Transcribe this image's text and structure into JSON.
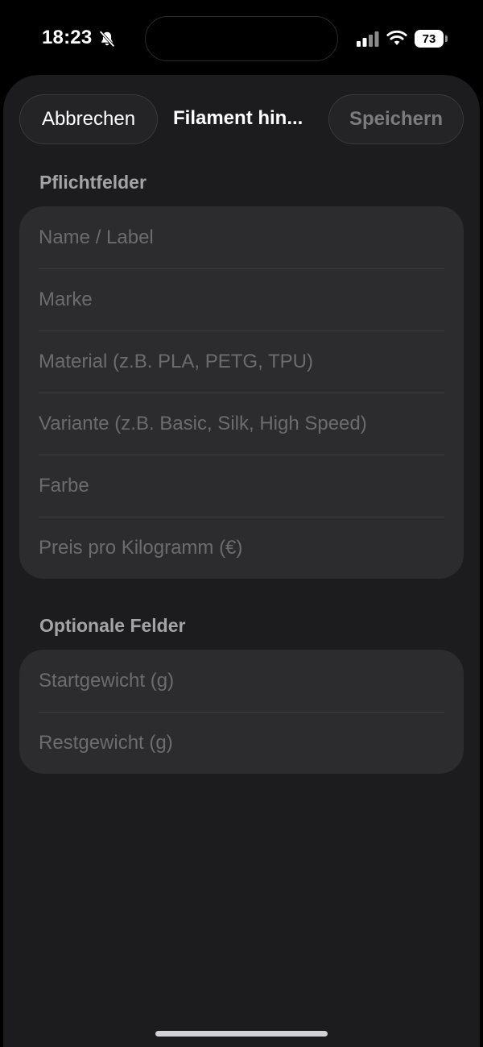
{
  "status_bar": {
    "time": "18:23",
    "battery_level": "73",
    "icons": [
      "bell-slash-icon",
      "cellular-signal-icon",
      "wifi-icon",
      "battery-icon"
    ]
  },
  "navigation": {
    "cancel_label": "Abbrechen",
    "title": "Filament hin...",
    "save_label": "Speichern",
    "save_enabled": false
  },
  "required_section": {
    "header": "Pflichtfelder",
    "fields": [
      {
        "placeholder": "Name / Label",
        "value": ""
      },
      {
        "placeholder": "Marke",
        "value": ""
      },
      {
        "placeholder": "Material (z.B. PLA, PETG, TPU)",
        "value": ""
      },
      {
        "placeholder": "Variante (z.B. Basic, Silk, High Speed)",
        "value": ""
      },
      {
        "placeholder": "Farbe",
        "value": ""
      },
      {
        "placeholder": "Preis pro Kilogramm (€)",
        "value": ""
      }
    ]
  },
  "optional_section": {
    "header": "Optionale Felder",
    "fields": [
      {
        "placeholder": "Startgewicht (g)",
        "value": ""
      },
      {
        "placeholder": "Restgewicht (g)",
        "value": ""
      }
    ]
  },
  "colors": {
    "background": "#000000",
    "sheet": "#1c1c1e",
    "group": "#2c2c2e",
    "placeholder": "#6c6c70",
    "section_header": "#a3a3a8",
    "disabled_text": "#7c7c80"
  }
}
